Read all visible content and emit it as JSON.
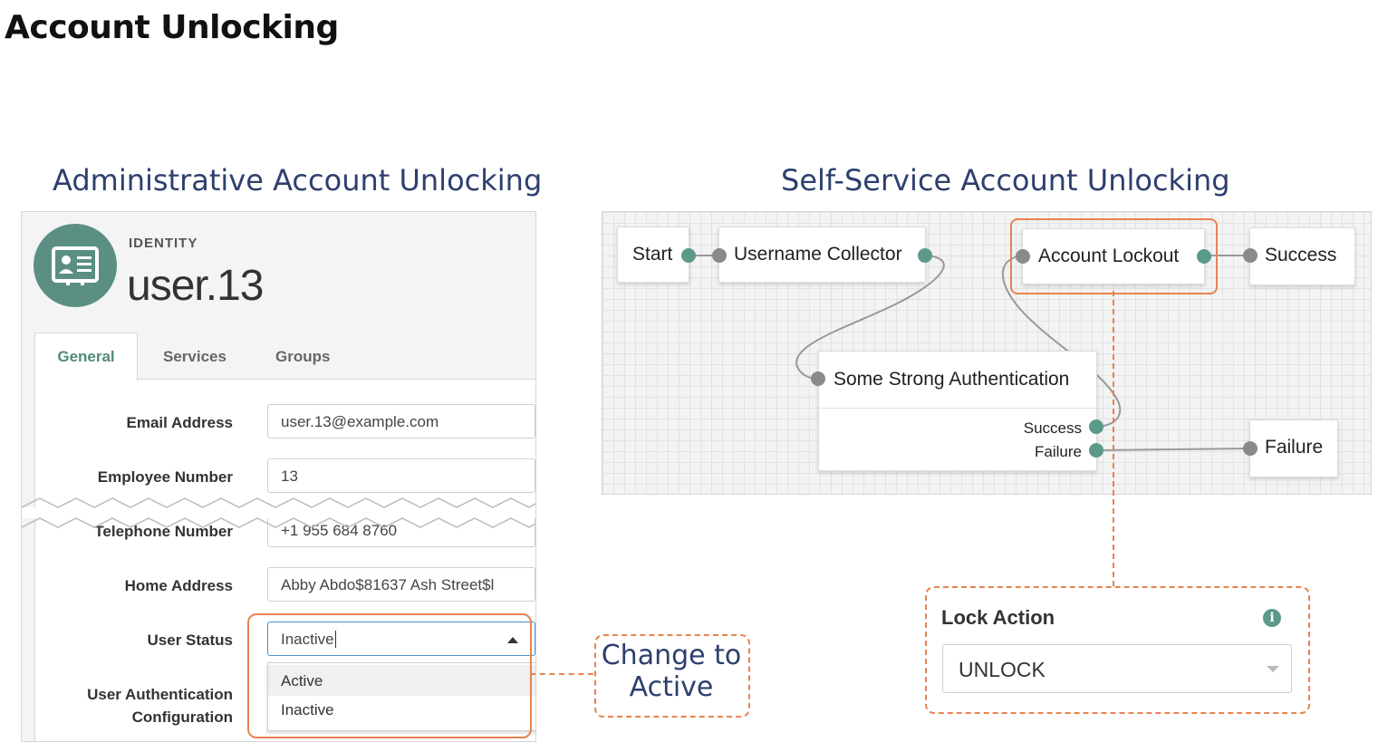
{
  "page": {
    "title": "Account Unlocking"
  },
  "admin": {
    "section_title": "Administrative Account Unlocking",
    "identity_label": "IDENTITY",
    "user_name": "user.13",
    "tabs": [
      {
        "label": "General"
      },
      {
        "label": "Services"
      },
      {
        "label": "Groups"
      }
    ],
    "fields": {
      "email": {
        "label": "Email Address",
        "value": "user.13@example.com"
      },
      "employee_number": {
        "label": "Employee Number",
        "value": "13"
      },
      "telephone": {
        "label": "Telephone Number",
        "value": "+1 955 684 8760"
      },
      "home_address": {
        "label": "Home Address",
        "value": "Abby Abdo$81637 Ash Street$l"
      },
      "user_status": {
        "label": "User Status",
        "value": "Inactive"
      },
      "user_auth_config": {
        "label_line1": "User Authentication",
        "label_line2": "Configuration"
      }
    },
    "status_options": [
      "Active",
      "Inactive"
    ]
  },
  "callout": {
    "line1": "Change to",
    "line2": "Active"
  },
  "self_service": {
    "section_title": "Self-Service Account Unlocking",
    "nodes": {
      "start": "Start",
      "username_collector": "Username Collector",
      "account_lockout": "Account Lockout",
      "success": "Success",
      "strong_auth": "Some Strong Authentication",
      "strong_auth_success": "Success",
      "strong_auth_failure": "Failure",
      "failure": "Failure"
    },
    "lock_action": {
      "label": "Lock Action",
      "value": "UNLOCK"
    }
  },
  "colors": {
    "accent_orange": "#e8834f",
    "title_navy": "#2e3f6e",
    "teal": "#5b9a8b",
    "tab_active": "#4f8b78"
  }
}
